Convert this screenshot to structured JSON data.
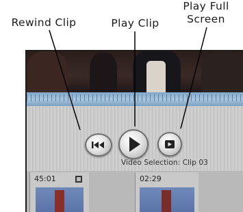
{
  "callouts": {
    "rewind": "Rewind Clip",
    "play": "Play Clip",
    "fullscreen_line1": "Play Full",
    "fullscreen_line2": "Screen"
  },
  "player": {
    "selection_label": "Video Selection: Clip 03",
    "buttons": [
      {
        "name": "rewind",
        "icon": "rewind-icon"
      },
      {
        "name": "play",
        "icon": "play-icon"
      },
      {
        "name": "fullscreen",
        "icon": "fullscreen-icon"
      }
    ]
  },
  "clips": [
    {
      "time": "45:01",
      "icon": "film-icon"
    },
    {
      "time": "02:29"
    }
  ],
  "colors": {
    "scrubber": "#9dbcd8",
    "button_glyph": "#222222",
    "thumb": "#5f7aac"
  }
}
